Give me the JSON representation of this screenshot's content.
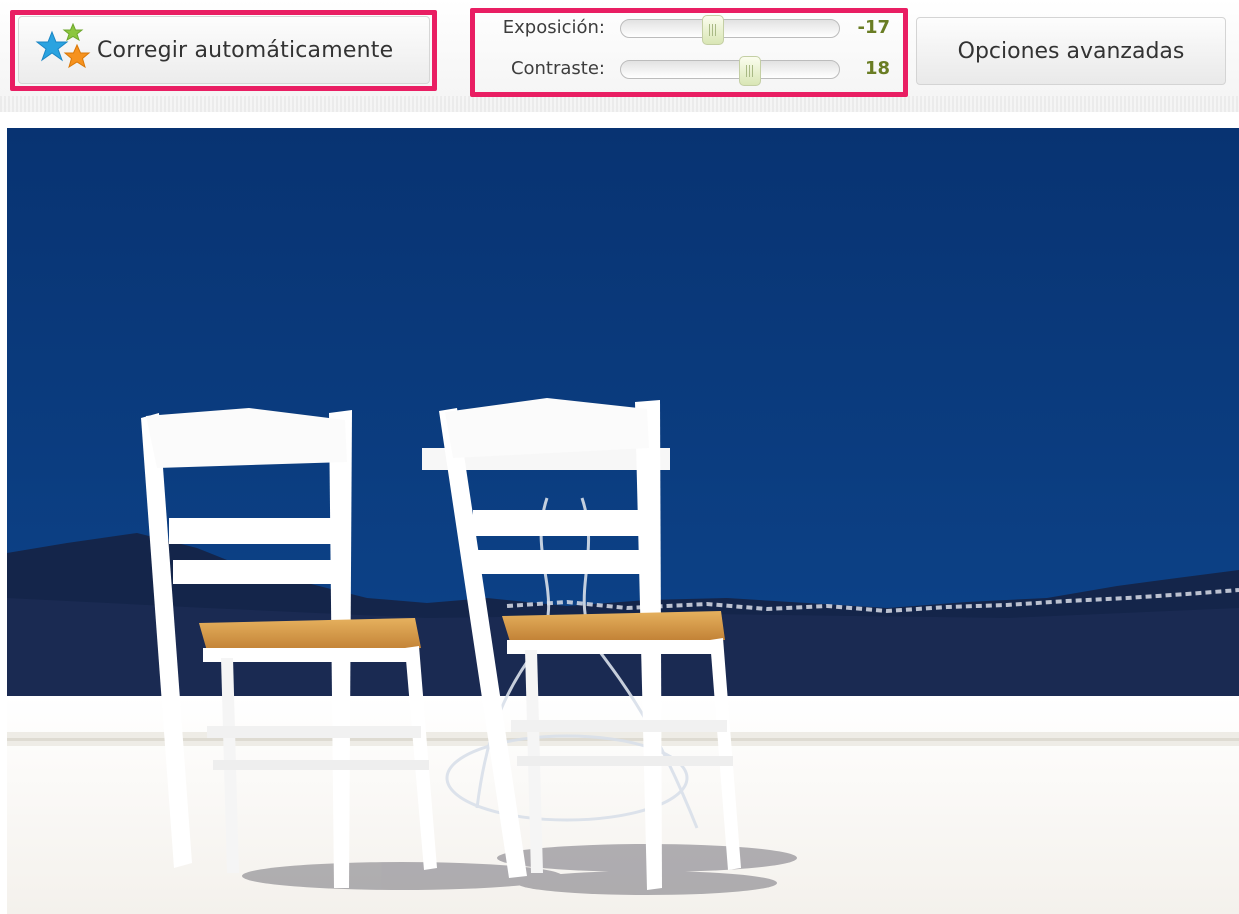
{
  "toolbar": {
    "auto_fix_label": "Corregir automáticamente",
    "auto_fix_icon": "stars-icon",
    "advanced_label": "Opciones avanzadas"
  },
  "sliders": [
    {
      "label": "Exposición:",
      "value": "-17",
      "level": 0.42
    },
    {
      "label": "Contraste:",
      "value": "18",
      "level": 0.59
    }
  ],
  "colors": {
    "highlight": "#e91e63",
    "value_text": "#6a7d24",
    "sky": "#0a3a7a"
  }
}
